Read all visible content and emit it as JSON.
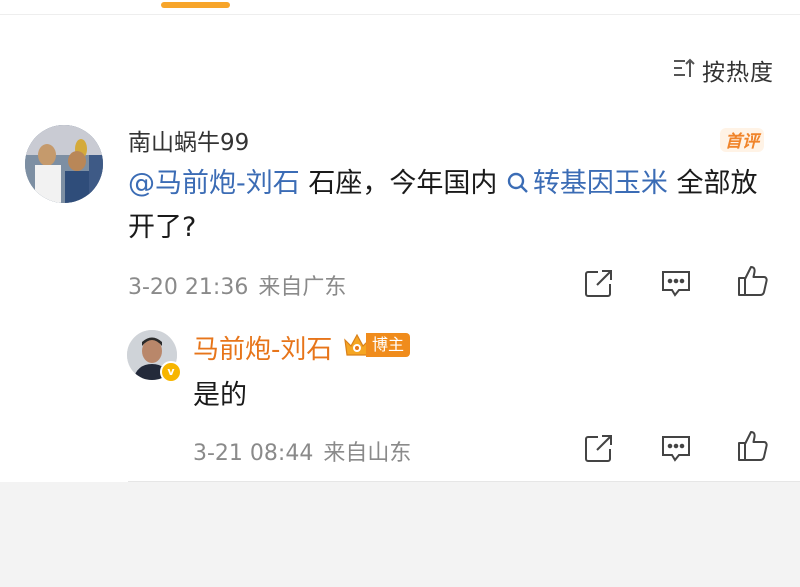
{
  "sort": {
    "label": "按热度",
    "icon": "sort-icon"
  },
  "comment": {
    "username": "南山蜗牛99",
    "badge_label": "首评",
    "mention": "@马前炮-刘石",
    "text_before_topic": " 石座，今年国内",
    "topic": "转基因玉米",
    "text_after_topic": " 全部放开了?",
    "timestamp": "3-20 21:36",
    "location": "来自广东",
    "actions": [
      "share-icon",
      "comment-icon",
      "like-icon"
    ]
  },
  "reply": {
    "username": "马前炮-刘石",
    "verified_mark": "v",
    "badge_label": "博主",
    "text": "是的",
    "timestamp": "3-21 08:44",
    "location": "来自山东",
    "actions": [
      "share-icon",
      "comment-icon",
      "like-icon"
    ]
  },
  "colors": {
    "accent": "#f7a52a",
    "link": "#3b6cb5",
    "blogger_name": "#e7751a",
    "meta_text": "#8a8a8a",
    "footer_bg": "#f3f3f3"
  }
}
